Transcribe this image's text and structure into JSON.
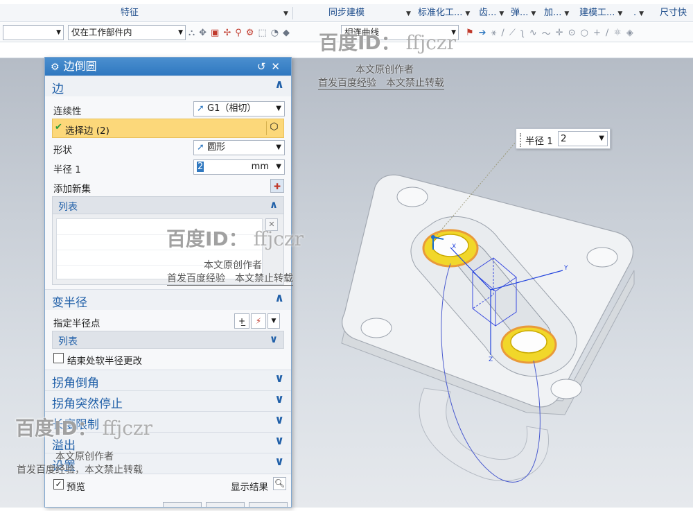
{
  "ribbon": {
    "groups": [
      {
        "label": "特征"
      },
      {
        "label": "同步建模"
      },
      {
        "label": "标准化工..."
      },
      {
        "label": "齿..."
      },
      {
        "label": "弹..."
      },
      {
        "label": "加..."
      },
      {
        "label": "建模工..."
      },
      {
        "label": "."
      },
      {
        "label": "尺寸快"
      }
    ]
  },
  "selection_bar": {
    "filter_value": "",
    "scope_value": "仅在工作部件内",
    "curve_rule_value": "相连曲线"
  },
  "dialog": {
    "title": "边倒圆",
    "sections": {
      "edge": {
        "title": "边",
        "continuity_label": "连续性",
        "continuity_value": "G1（相切）",
        "select_edge_label": "选择边 (2)",
        "shape_label": "形状",
        "shape_value": "圆形",
        "radius_label": "半径 1",
        "radius_value": "2",
        "radius_unit": "mm",
        "add_new_set_label": "添加新集",
        "list_label": "列表"
      },
      "variable_radius": {
        "title": "变半径",
        "specify_point_label": "指定半径点",
        "list_label": "列表",
        "soft_radius_label": "结束处软半径更改"
      },
      "corner_setback": {
        "title": "拐角倒角"
      },
      "corner_stop": {
        "title": "拐角突然停止"
      },
      "length_limit": {
        "title": "长度限制"
      },
      "overflow": {
        "title": "溢出"
      },
      "settings": {
        "title": "设置"
      }
    },
    "preview_label": "预览",
    "show_result_label": "显示结果"
  },
  "radius_tip": {
    "label": "半径 1",
    "value": "2"
  },
  "watermarks": [
    {
      "id": "百度ID：",
      "user": "ffjczr",
      "line1": "本文原创作者",
      "line2": "首发百度经验",
      "line3": "本文禁止转载"
    }
  ],
  "axes": {
    "x": "X",
    "y": "Y",
    "z": "Z"
  }
}
